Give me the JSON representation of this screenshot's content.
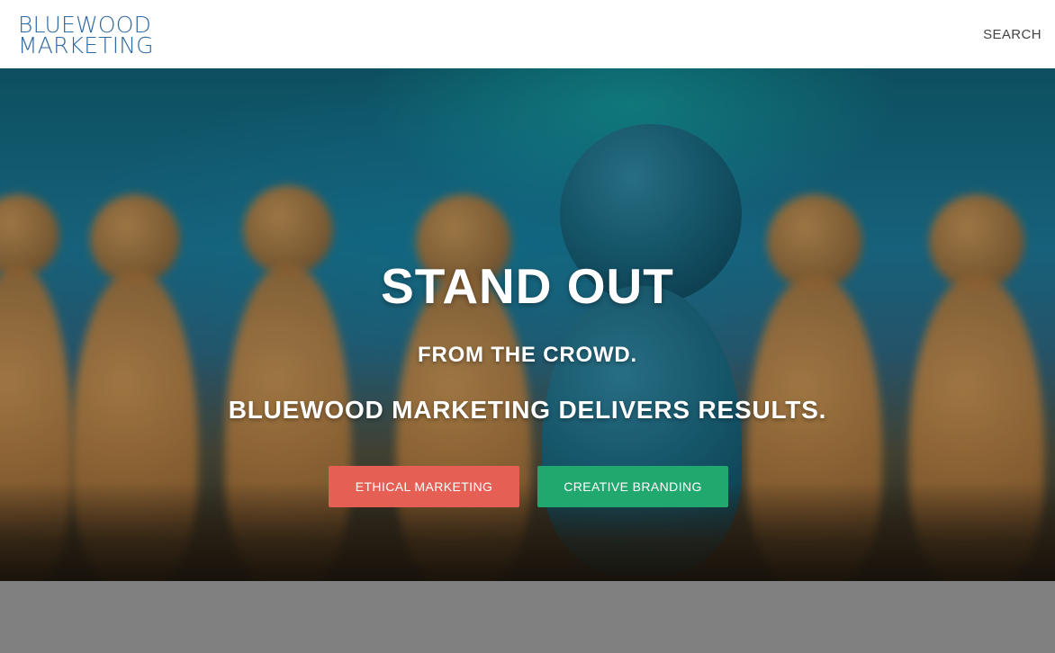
{
  "header": {
    "logo_line1": "BLUEWOOD",
    "logo_line2": "MARKETING",
    "search_label": "SEARCH"
  },
  "hero": {
    "title": "STAND OUT",
    "subtitle": "FROM THE CROWD.",
    "tagline": "BLUEWOOD MARKETING DELIVERS RESULTS.",
    "buttons": [
      {
        "label": "ETHICAL MARKETING",
        "color": "#e65f54"
      },
      {
        "label": "CREATIVE BRANDING",
        "color": "#21a86f"
      }
    ]
  },
  "colors": {
    "logo": "#2f6aa3",
    "header_bg": "#ffffff",
    "footer_bg": "#808080"
  }
}
